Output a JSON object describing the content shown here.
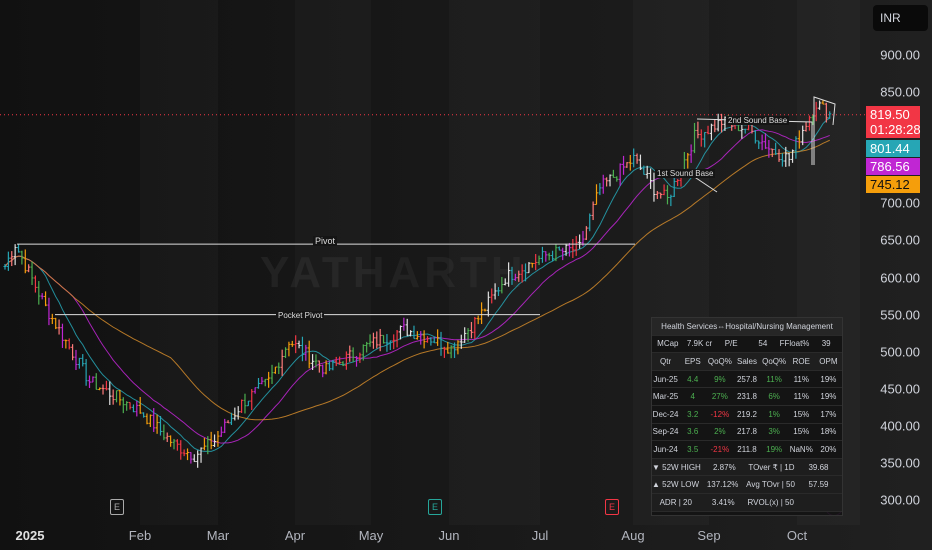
{
  "currency": "INR",
  "watermark": "YATHARTH",
  "price_tags": {
    "last": "819.50",
    "countdown": "01:28:28",
    "ma1": "801.44",
    "ma2": "786.56",
    "ma3": "745.12"
  },
  "colors": {
    "last": "#f23645",
    "ma1": "#26a6b5",
    "ma2": "#c026d3",
    "ma3": "#f59e0b"
  },
  "annotations": {
    "pivot": "Pivot",
    "pocket_pivot": "Pocket Pivot",
    "base1": "1st Sound Base",
    "base2": "2nd Sound Base"
  },
  "events": [
    "E",
    "E",
    "E"
  ],
  "chart_data": {
    "type": "ohlc",
    "yticks": [
      "900.00",
      "850.00",
      "800.00",
      "750.00",
      "700.00",
      "650.00",
      "600.00",
      "550.00",
      "500.00",
      "450.00",
      "400.00",
      "350.00",
      "300.00"
    ],
    "ylim": [
      300,
      900
    ],
    "xticks": [
      "2025",
      "Feb",
      "Mar",
      "Apr",
      "May",
      "Jun",
      "Jul",
      "Aug",
      "Sep",
      "Oct"
    ],
    "levels": {
      "pivot": 645,
      "pocket_pivot": 550,
      "last": 819.5
    },
    "keypoints": [
      [
        0,
        615
      ],
      [
        3,
        645
      ],
      [
        12,
        560
      ],
      [
        25,
        460
      ],
      [
        40,
        420
      ],
      [
        50,
        375
      ],
      [
        56,
        360
      ],
      [
        62,
        380
      ],
      [
        70,
        430
      ],
      [
        78,
        460
      ],
      [
        84,
        515
      ],
      [
        95,
        475
      ],
      [
        108,
        510
      ],
      [
        118,
        530
      ],
      [
        125,
        520
      ],
      [
        132,
        505
      ],
      [
        140,
        545
      ],
      [
        148,
        600
      ],
      [
        160,
        630
      ],
      [
        170,
        640
      ],
      [
        176,
        720
      ],
      [
        186,
        760
      ],
      [
        192,
        720
      ],
      [
        196,
        705
      ],
      [
        204,
        790
      ],
      [
        212,
        810
      ],
      [
        220,
        800
      ],
      [
        226,
        775
      ],
      [
        232,
        760
      ],
      [
        236,
        800
      ],
      [
        240,
        835
      ],
      [
        244,
        820
      ]
    ]
  },
  "table": {
    "title": "Health Services⇔Hospital/Nursing Management",
    "info": [
      "MCap",
      "7.9K cr",
      "P/E",
      "54",
      "FFloat%",
      "39"
    ],
    "headers": [
      "Qtr",
      "EPS",
      "QoQ%",
      "Sales",
      "QoQ%",
      "ROE",
      "OPM"
    ],
    "rows": [
      [
        "Jun-25",
        "4.4",
        "9%",
        "257.8",
        "11%",
        "11%",
        "19%"
      ],
      [
        "Mar-25",
        "4",
        "27%",
        "231.8",
        "6%",
        "11%",
        "19%"
      ],
      [
        "Dec-24",
        "3.2",
        "-12%",
        "219.2",
        "1%",
        "15%",
        "17%"
      ],
      [
        "Sep-24",
        "3.6",
        "2%",
        "217.8",
        "3%",
        "15%",
        "18%"
      ],
      [
        "Jun-24",
        "3.5",
        "-21%",
        "211.8",
        "19%",
        "NaN%",
        "20%"
      ]
    ],
    "footer": [
      [
        "▼ 52W HIGH",
        "2.87%",
        "TOver ₹ | 1D",
        "39.68"
      ],
      [
        "▲ 52W LOW",
        "137.12%",
        "Avg TOvr | 50",
        "57.59"
      ],
      [
        "ADR | 20",
        "3.41%",
        "RVOL(x) | 50",
        ""
      ]
    ]
  }
}
